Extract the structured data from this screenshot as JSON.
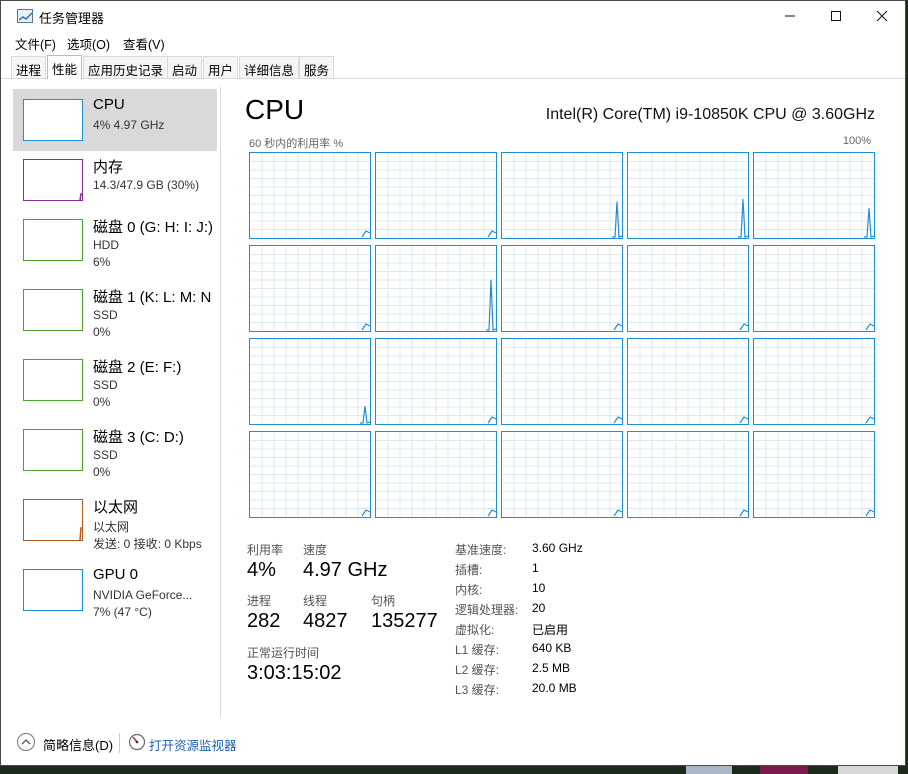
{
  "window": {
    "title": "任务管理器"
  },
  "menu": [
    "文件(F)",
    "选项(O)",
    "查看(V)"
  ],
  "tabs": [
    "进程",
    "性能",
    "应用历史记录",
    "启动",
    "用户",
    "详细信息",
    "服务"
  ],
  "active_tab": "性能",
  "sidebar": [
    {
      "title": "CPU",
      "line1": "4% 4.97 GHz",
      "line2": "",
      "color": "#1e8fd6",
      "selected": true
    },
    {
      "title": "内存",
      "line1": "14.3/47.9 GB (30%)",
      "line2": "",
      "color": "#8b2a9b",
      "selected": false
    },
    {
      "title": "磁盘 0 (G: H: I: J:)",
      "line1": "HDD",
      "line2": "6%",
      "color": "#4ca32c",
      "selected": false
    },
    {
      "title": "磁盘 1 (K: L: M: N",
      "line1": "SSD",
      "line2": "0%",
      "color": "#4ca32c",
      "selected": false
    },
    {
      "title": "磁盘 2 (E: F:)",
      "line1": "SSD",
      "line2": "0%",
      "color": "#4ca32c",
      "selected": false
    },
    {
      "title": "磁盘 3 (C: D:)",
      "line1": "SSD",
      "line2": "0%",
      "color": "#4ca32c",
      "selected": false
    },
    {
      "title": "以太网",
      "line1": "以太网",
      "line2": "发送: 0 接收: 0 Kbps",
      "color": "#b35a1b",
      "selected": false
    },
    {
      "title": "GPU 0",
      "line1": "NVIDIA GeForce...",
      "line2": "7% (47 °C)",
      "color": "#1e8fd6",
      "selected": false
    }
  ],
  "main": {
    "title": "CPU",
    "model": "Intel(R) Core(TM) i9-10850K CPU @ 3.60GHz",
    "graph_label": "60 秒内的利用率 %",
    "graph_max": "100%"
  },
  "stats": {
    "utilization": {
      "label": "利用率",
      "value": "4%"
    },
    "speed": {
      "label": "速度",
      "value": "4.97 GHz"
    },
    "processes": {
      "label": "进程",
      "value": "282"
    },
    "threads": {
      "label": "线程",
      "value": "4827"
    },
    "handles": {
      "label": "句柄",
      "value": "135277"
    },
    "uptime": {
      "label": "正常运行时间",
      "value": "3:03:15:02"
    }
  },
  "details": [
    {
      "label": "基准速度:",
      "value": "3.60 GHz"
    },
    {
      "label": "插槽:",
      "value": "1"
    },
    {
      "label": "内核:",
      "value": "10"
    },
    {
      "label": "逻辑处理器:",
      "value": "20"
    },
    {
      "label": "虚拟化:",
      "value": "已启用"
    },
    {
      "label": "L1 缓存:",
      "value": "640 KB"
    },
    {
      "label": "L2 缓存:",
      "value": "2.5 MB"
    },
    {
      "label": "L3 缓存:",
      "value": "20.0 MB"
    }
  ],
  "footer": {
    "fewer_details": "简略信息(D)",
    "resource_monitor": "打开资源监视器"
  },
  "colors": {
    "cpu_line": "#1e8fd6",
    "grid": "#dbe9f5",
    "selected_bg": "#d9d9d9"
  },
  "icons": {
    "app": "task-manager-icon",
    "fewer": "chevron-up-icon",
    "resmon": "resource-monitor-icon"
  }
}
